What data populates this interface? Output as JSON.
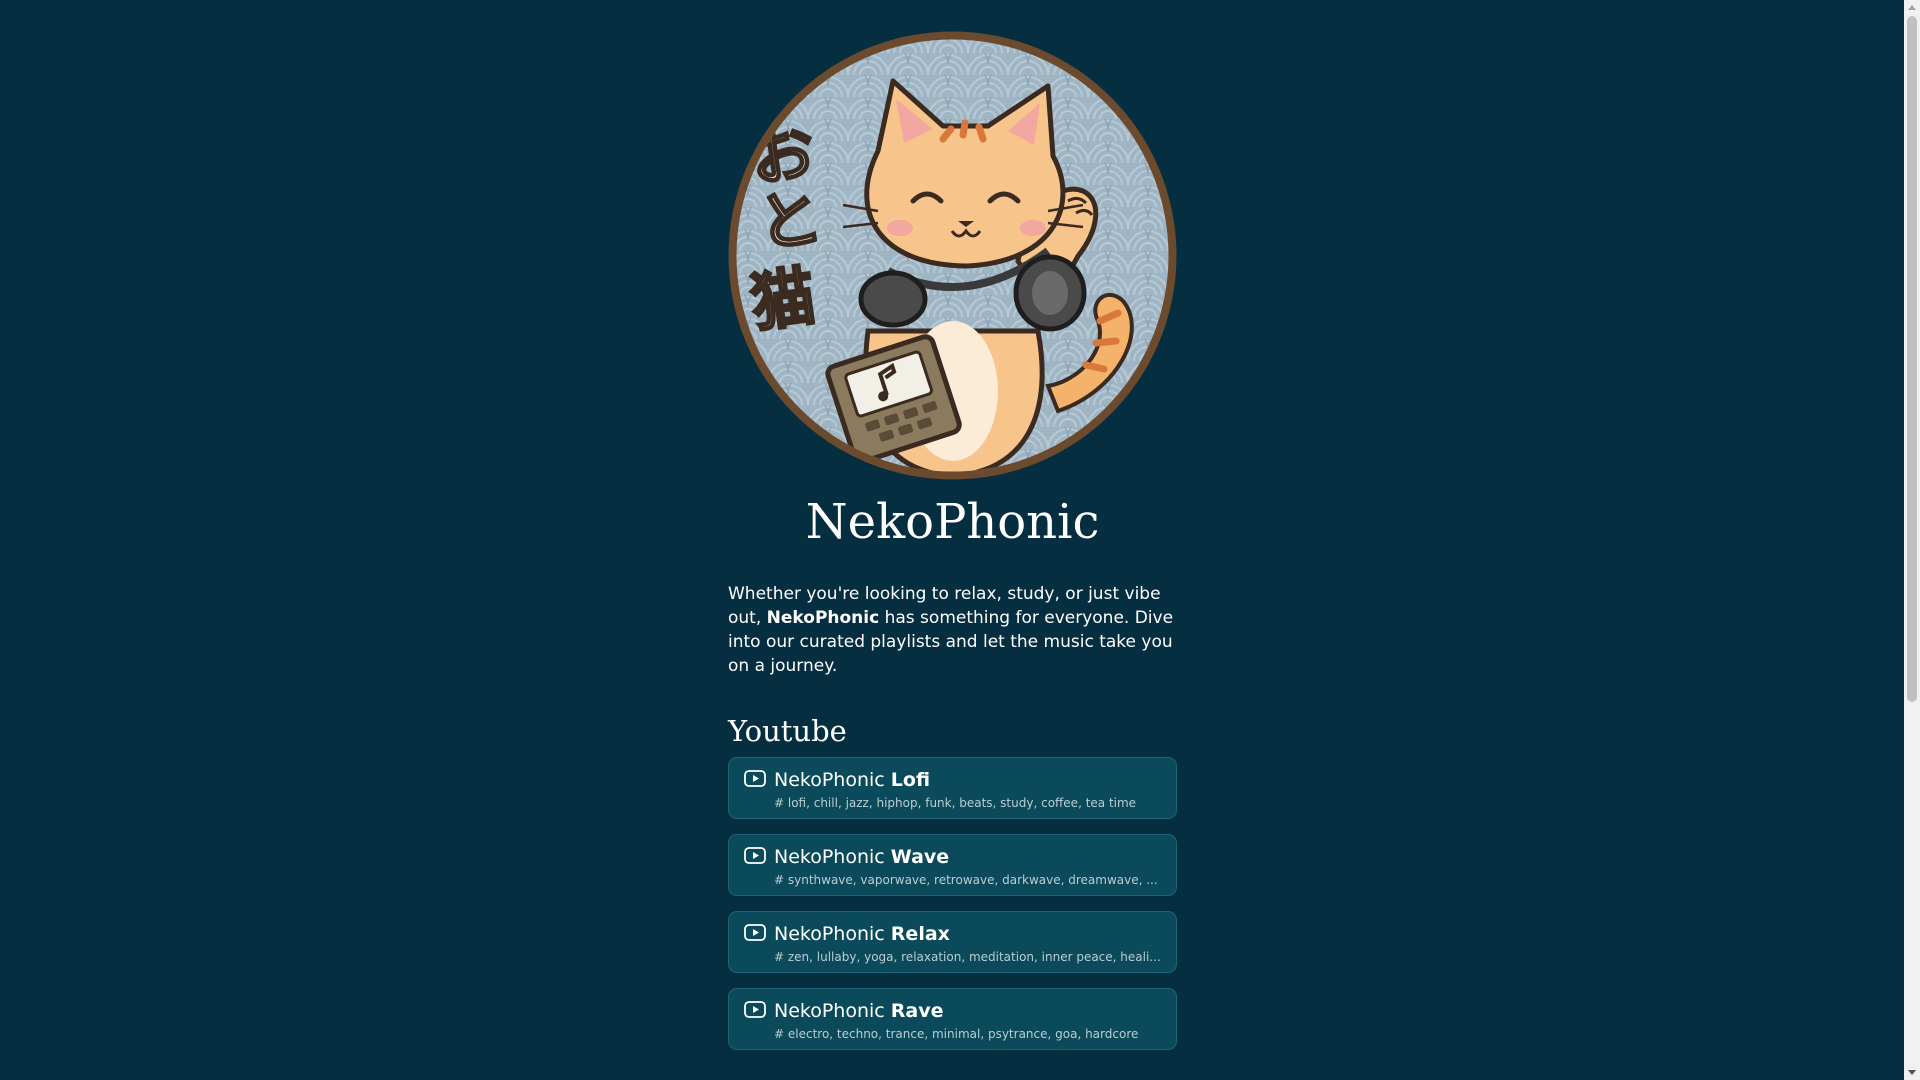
{
  "site": {
    "title": "NekoPhonic",
    "logo_text": "おと猫",
    "intro": {
      "before": "Whether you're looking to relax, study, or just vibe out, ",
      "bold": "NekoPhonic",
      "after": " has something for everyone. Dive into our curated playlists and let the music take you on a journey."
    }
  },
  "youtube": {
    "heading": "Youtube",
    "playlists": [
      {
        "prefix": "NekoPhonic ",
        "name": "Lofi",
        "tags": "# lofi, chill, jazz, hiphop, funk, beats, study, coffee, tea time"
      },
      {
        "prefix": "NekoPhonic ",
        "name": "Wave",
        "tags": "# synthwave, vaporwave, retrowave, darkwave, dreamwave, ..."
      },
      {
        "prefix": "NekoPhonic ",
        "name": "Relax",
        "tags": "# zen, lullaby, yoga, relaxation, meditation, inner peace, heali..."
      },
      {
        "prefix": "NekoPhonic ",
        "name": "Rave",
        "tags": "# electro, techno, trance, minimal, psytrance, goa, hardcore"
      }
    ]
  },
  "colors": {
    "background": "#052f40",
    "card": "#0b4a5a",
    "card_border": "#1e6475",
    "logo_ring": "#6b4a2e"
  },
  "icons": {
    "playlist": "youtube-play-icon"
  }
}
